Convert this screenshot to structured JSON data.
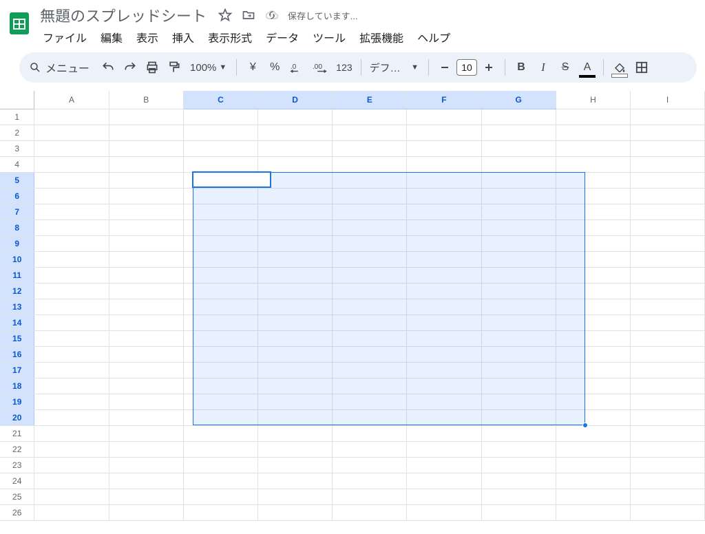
{
  "header": {
    "title": "無題のスプレッドシート",
    "saving_text": "保存しています...",
    "icons": {
      "star": "star-icon",
      "move": "folder-move-icon",
      "cloud": "cloud-status-icon"
    }
  },
  "menubar": [
    "ファイル",
    "編集",
    "表示",
    "挿入",
    "表示形式",
    "データ",
    "ツール",
    "拡張機能",
    "ヘルプ"
  ],
  "toolbar": {
    "search_label": "メニュー",
    "zoom": "100%",
    "currency": "¥",
    "percent": "%",
    "dec_dec": ".0",
    "dec_inc": ".00",
    "numfmt": "123",
    "font": "デフォ...",
    "font_size": "10",
    "bold": "B",
    "italic": "I",
    "strike": "S",
    "textcolor": "A"
  },
  "grid": {
    "columns": [
      "A",
      "B",
      "C",
      "D",
      "E",
      "F",
      "G",
      "H",
      "I"
    ],
    "rows": 26,
    "selected_cols": [
      "C",
      "D",
      "E",
      "F",
      "G"
    ],
    "selected_rows_from": 5,
    "selected_rows_to": 20,
    "active_cell": "C5"
  },
  "colors": {
    "brand_green": "#0f9d58",
    "selection_blue": "#1a73e8",
    "toolbar_bg": "#edf2fa"
  }
}
